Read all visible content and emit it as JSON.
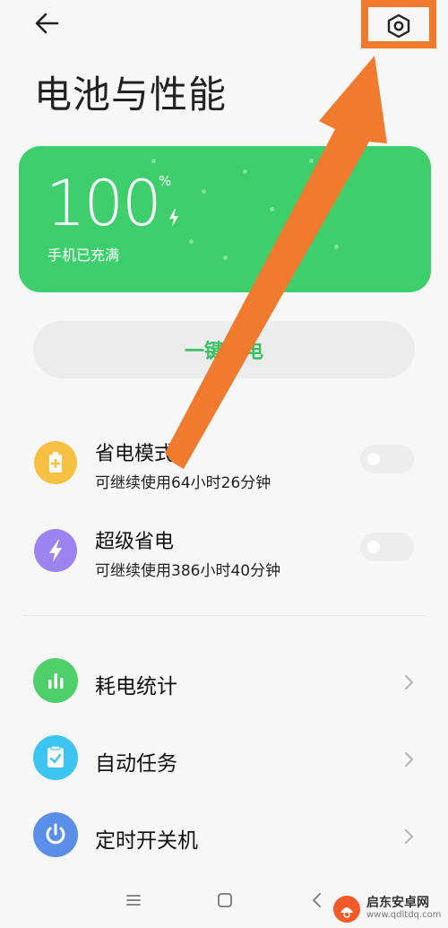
{
  "header": {
    "back_icon": "arrow-left-icon",
    "settings_icon": "settings-hex-gear-icon",
    "title": "电池与性能"
  },
  "battery": {
    "level": "100",
    "unit": "%",
    "status": "手机已充满",
    "charging_icon": "lightning-bolt-icon",
    "card_color": "#3ecf6c"
  },
  "one_tap_save": {
    "label": "一键省电"
  },
  "modes": [
    {
      "title": "省电模式",
      "subtitle": "可继续使用64小时26分钟",
      "icon": "battery-plus-icon",
      "icon_color": "#f6c142",
      "enabled": false
    },
    {
      "title": "超级省电",
      "subtitle": "可继续使用386小时40分钟",
      "icon": "lightning-bolt-icon",
      "icon_color": "#9b84f0",
      "enabled": false
    }
  ],
  "menu": [
    {
      "label": "耗电统计",
      "icon": "bar-chart-icon",
      "icon_color": "#4fcf6a"
    },
    {
      "label": "自动任务",
      "icon": "clipboard-check-icon",
      "icon_color": "#3ec4f0"
    },
    {
      "label": "定时开关机",
      "icon": "power-icon",
      "icon_color": "#5b8ee8"
    }
  ],
  "navbar": {
    "icons": [
      "menu-icon",
      "home-square-icon",
      "back-chevron-icon"
    ]
  },
  "watermark": {
    "name": "启东安卓网",
    "url": "www.qdltdq.com"
  },
  "annotation": {
    "color": "#f07a2e"
  }
}
